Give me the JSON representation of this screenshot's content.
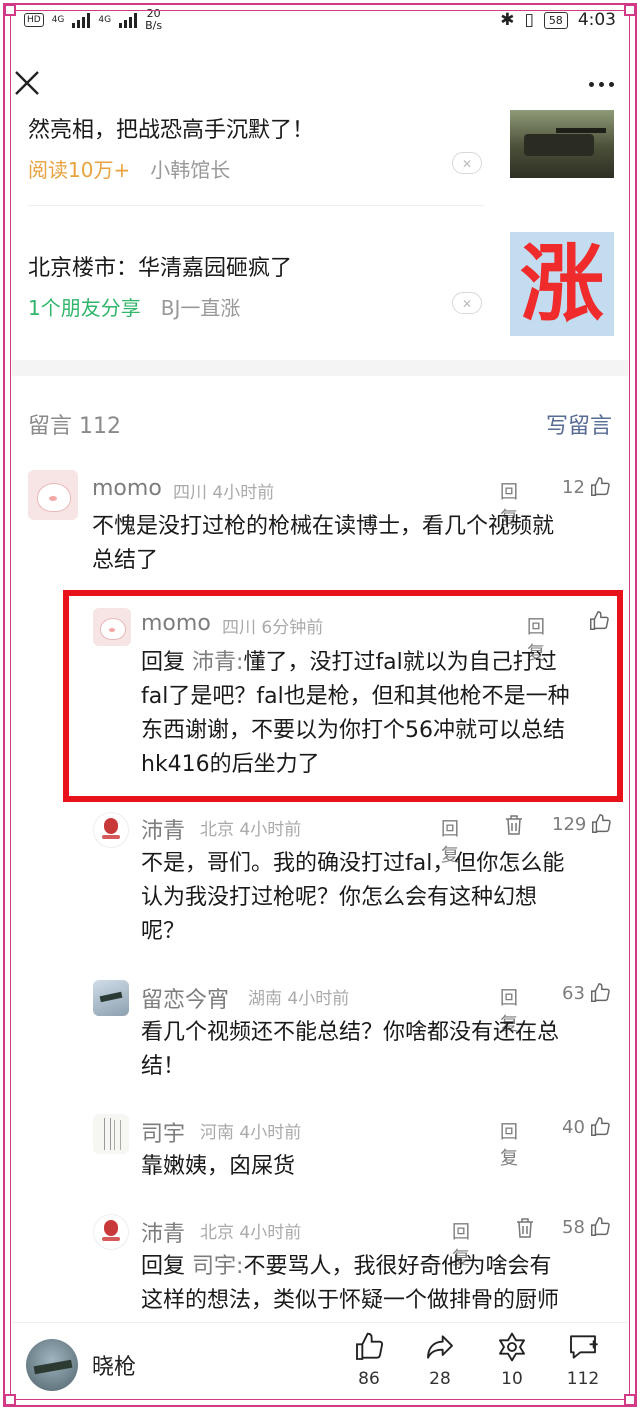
{
  "status_bar": {
    "hd_badge": "HD",
    "sim1": "4G",
    "sim2": "4G",
    "net_speed": "20",
    "net_unit": "B/s",
    "battery": "58",
    "time": "4:03"
  },
  "recommendations": [
    {
      "title": "然亮相，把战恐高手沉默了！",
      "meta_accent": "阅读10万+",
      "meta_accent_color": "#e8a23e",
      "source": "小韩馆长"
    },
    {
      "title": "北京楼市：华清嘉园砸疯了",
      "meta_accent": "1个朋友分享",
      "meta_accent_color": "#2fb66a",
      "source": "BJ一直涨",
      "thumb_text": "涨"
    }
  ],
  "comments_header": {
    "label": "留言 112",
    "write": "写留言"
  },
  "comments": [
    {
      "nick": "momo",
      "loc": "四川 4小时前",
      "reply": "回复",
      "likes": "12",
      "text_lines": [
        "不愧是没打过枪的枪械在读博士，看几个视频就",
        "总结了"
      ]
    },
    {
      "nick": "momo",
      "loc": "四川 6分钟前",
      "reply": "回复",
      "likes": "",
      "prefix": "回复",
      "mention": "沛青:",
      "text_lines": [
        "懂了，没打过fal就以为自己打过",
        "fal了是吧？fal也是枪，但和其他枪不是一种",
        "东西谢谢，不要以为你打个56冲就可以总结",
        "hk416的后坐力了"
      ]
    },
    {
      "nick": "沛青",
      "loc": "北京 4小时前",
      "reply": "回复",
      "likes": "129",
      "text_lines": [
        "不是，哥们。我的确没打过fal，但你怎么能",
        "认为我没打过枪呢？你怎么会有这种幻想",
        "呢？"
      ]
    },
    {
      "nick": "留恋今宵",
      "loc": "湖南 4小时前",
      "reply": "回复",
      "likes": "63",
      "text_lines": [
        "看几个视频还不能总结？你啥都没有还在总",
        "结！"
      ]
    },
    {
      "nick": "司宇",
      "loc": "河南 4小时前",
      "reply": "回复",
      "likes": "40",
      "text_lines": [
        "靠嫩姨，囟屎货"
      ]
    },
    {
      "nick": "沛青",
      "loc": "北京 4小时前",
      "reply": "回复",
      "likes": "58",
      "prefix": "回复",
      "mention": "司宇:",
      "text_lines": [
        "不要骂人，我很好奇他为啥会有",
        "这样的想法，类似于怀疑一个做排骨的厨师"
      ]
    }
  ],
  "bottom_bar": {
    "user_name": "晓枪",
    "like_count": "86",
    "share_count": "28",
    "wow_count": "10",
    "comment_count": "112"
  },
  "colors": {
    "frame": "#d33a86",
    "highlight": "#e8131a",
    "link": "#576b95"
  }
}
